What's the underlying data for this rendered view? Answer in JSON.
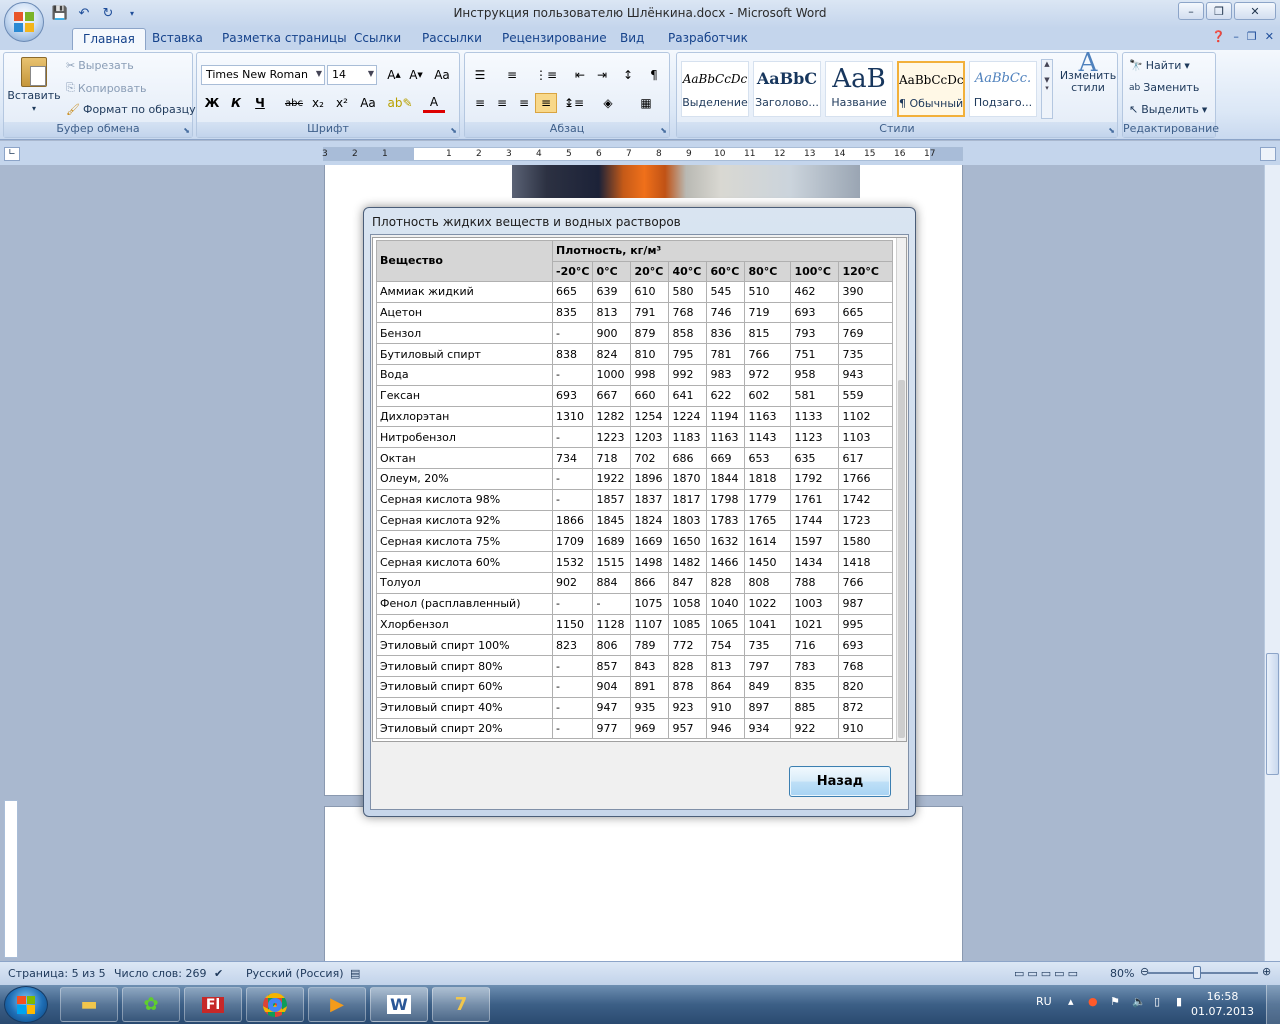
{
  "window": {
    "title": "Инструкция пользователю Шлёнкина.docx - Microsoft Word",
    "minimize": "–",
    "maximize": "❐",
    "close": "✕"
  },
  "ribbon_tabs": [
    "Главная",
    "Вставка",
    "Разметка страницы",
    "Ссылки",
    "Рассылки",
    "Рецензирование",
    "Вид",
    "Разработчик"
  ],
  "clipboard": {
    "paste": "Вставить",
    "cut": "Вырезать",
    "copy": "Копировать",
    "format_painter": "Формат по образцу",
    "label": "Буфер обмена"
  },
  "font": {
    "name": "Times New Roman",
    "size": "14",
    "label": "Шрифт",
    "bold": "Ж",
    "italic": "К",
    "underline": "Ч",
    "strike": "abc",
    "subscript": "x₂",
    "superscript": "x²",
    "case": "Aa"
  },
  "paragraph": {
    "label": "Абзац"
  },
  "styles": {
    "label": "Стили",
    "items": [
      {
        "sample": "AaBbCcDc",
        "name": "Выделение"
      },
      {
        "sample": "AaBbC",
        "name": "Заголово..."
      },
      {
        "sample": "AaB",
        "name": "Название"
      },
      {
        "sample": "AaBbCcDc",
        "name": "¶ Обычный"
      },
      {
        "sample": "AaBbCc.",
        "name": "Подзаго..."
      }
    ],
    "change": "Изменить стили"
  },
  "editing": {
    "label": "Редактирование",
    "find": "Найти",
    "replace": "Заменить",
    "select": "Выделить"
  },
  "ruler": {
    "ticks": [
      "3",
      "2",
      "1",
      "1",
      "2",
      "3",
      "4",
      "5",
      "6",
      "7",
      "8",
      "9",
      "10",
      "11",
      "12",
      "13",
      "14",
      "15",
      "16",
      "17"
    ]
  },
  "dialog": {
    "title": "Плотность жидких веществ и водных растворов",
    "header_substance": "Вещество",
    "header_density": "Плотность, кг/м³",
    "temps": [
      "-20°C",
      "0°C",
      "20°C",
      "40°C",
      "60°C",
      "80°C",
      "100°C",
      "120°C"
    ],
    "rows": [
      {
        "name": "Аммиак жидкий",
        "v": [
          "665",
          "639",
          "610",
          "580",
          "545",
          "510",
          "462",
          "390"
        ]
      },
      {
        "name": "Ацетон",
        "v": [
          "835",
          "813",
          "791",
          "768",
          "746",
          "719",
          "693",
          "665"
        ]
      },
      {
        "name": "Бензол",
        "v": [
          "-",
          "900",
          "879",
          "858",
          "836",
          "815",
          "793",
          "769"
        ]
      },
      {
        "name": "Бутиловый спирт",
        "v": [
          "838",
          "824",
          "810",
          "795",
          "781",
          "766",
          "751",
          "735"
        ]
      },
      {
        "name": "Вода",
        "v": [
          "-",
          "1000",
          "998",
          "992",
          "983",
          "972",
          "958",
          "943"
        ]
      },
      {
        "name": "Гексан",
        "v": [
          "693",
          "667",
          "660",
          "641",
          "622",
          "602",
          "581",
          "559"
        ]
      },
      {
        "name": "Дихлорэтан",
        "v": [
          "1310",
          "1282",
          "1254",
          "1224",
          "1194",
          "1163",
          "1133",
          "1102"
        ]
      },
      {
        "name": "Нитробензол",
        "v": [
          "-",
          "1223",
          "1203",
          "1183",
          "1163",
          "1143",
          "1123",
          "1103"
        ]
      },
      {
        "name": "Октан",
        "v": [
          "734",
          "718",
          "702",
          "686",
          "669",
          "653",
          "635",
          "617"
        ]
      },
      {
        "name": "Олеум, 20%",
        "v": [
          "-",
          "1922",
          "1896",
          "1870",
          "1844",
          "1818",
          "1792",
          "1766"
        ]
      },
      {
        "name": "Серная кислота 98%",
        "v": [
          "-",
          "1857",
          "1837",
          "1817",
          "1798",
          "1779",
          "1761",
          "1742"
        ]
      },
      {
        "name": "Серная кислота 92%",
        "v": [
          "1866",
          "1845",
          "1824",
          "1803",
          "1783",
          "1765",
          "1744",
          "1723"
        ]
      },
      {
        "name": "Серная кислота 75%",
        "v": [
          "1709",
          "1689",
          "1669",
          "1650",
          "1632",
          "1614",
          "1597",
          "1580"
        ]
      },
      {
        "name": "Серная кислота 60%",
        "v": [
          "1532",
          "1515",
          "1498",
          "1482",
          "1466",
          "1450",
          "1434",
          "1418"
        ]
      },
      {
        "name": "Толуол",
        "v": [
          "902",
          "884",
          "866",
          "847",
          "828",
          "808",
          "788",
          "766"
        ]
      },
      {
        "name": "Фенол (расплавленный)",
        "v": [
          "-",
          "-",
          "1075",
          "1058",
          "1040",
          "1022",
          "1003",
          "987"
        ]
      },
      {
        "name": "Хлорбензол",
        "v": [
          "1150",
          "1128",
          "1107",
          "1085",
          "1065",
          "1041",
          "1021",
          "995"
        ]
      },
      {
        "name": "Этиловый спирт 100%",
        "v": [
          "823",
          "806",
          "789",
          "772",
          "754",
          "735",
          "716",
          "693"
        ]
      },
      {
        "name": "Этиловый спирт 80%",
        "v": [
          "-",
          "857",
          "843",
          "828",
          "813",
          "797",
          "783",
          "768"
        ]
      },
      {
        "name": "Этиловый спирт 60%",
        "v": [
          "-",
          "904",
          "891",
          "878",
          "864",
          "849",
          "835",
          "820"
        ]
      },
      {
        "name": "Этиловый спирт 40%",
        "v": [
          "-",
          "947",
          "935",
          "923",
          "910",
          "897",
          "885",
          "872"
        ]
      },
      {
        "name": "Этиловый спирт 20%",
        "v": [
          "-",
          "977",
          "969",
          "957",
          "946",
          "934",
          "922",
          "910"
        ]
      }
    ],
    "back_button": "Назад"
  },
  "status": {
    "page": "Страница: 5 из 5",
    "words": "Число слов: 269",
    "language": "Русский (Россия)",
    "zoom": "80%"
  },
  "taskbar": {
    "lang": "RU",
    "time": "16:58",
    "date": "01.07.2013"
  },
  "colors": {
    "ribbon": "#dbe7f6",
    "accent": "#15428b",
    "selected_style": "#f2b03a",
    "table_header": "#d6d6d6"
  }
}
